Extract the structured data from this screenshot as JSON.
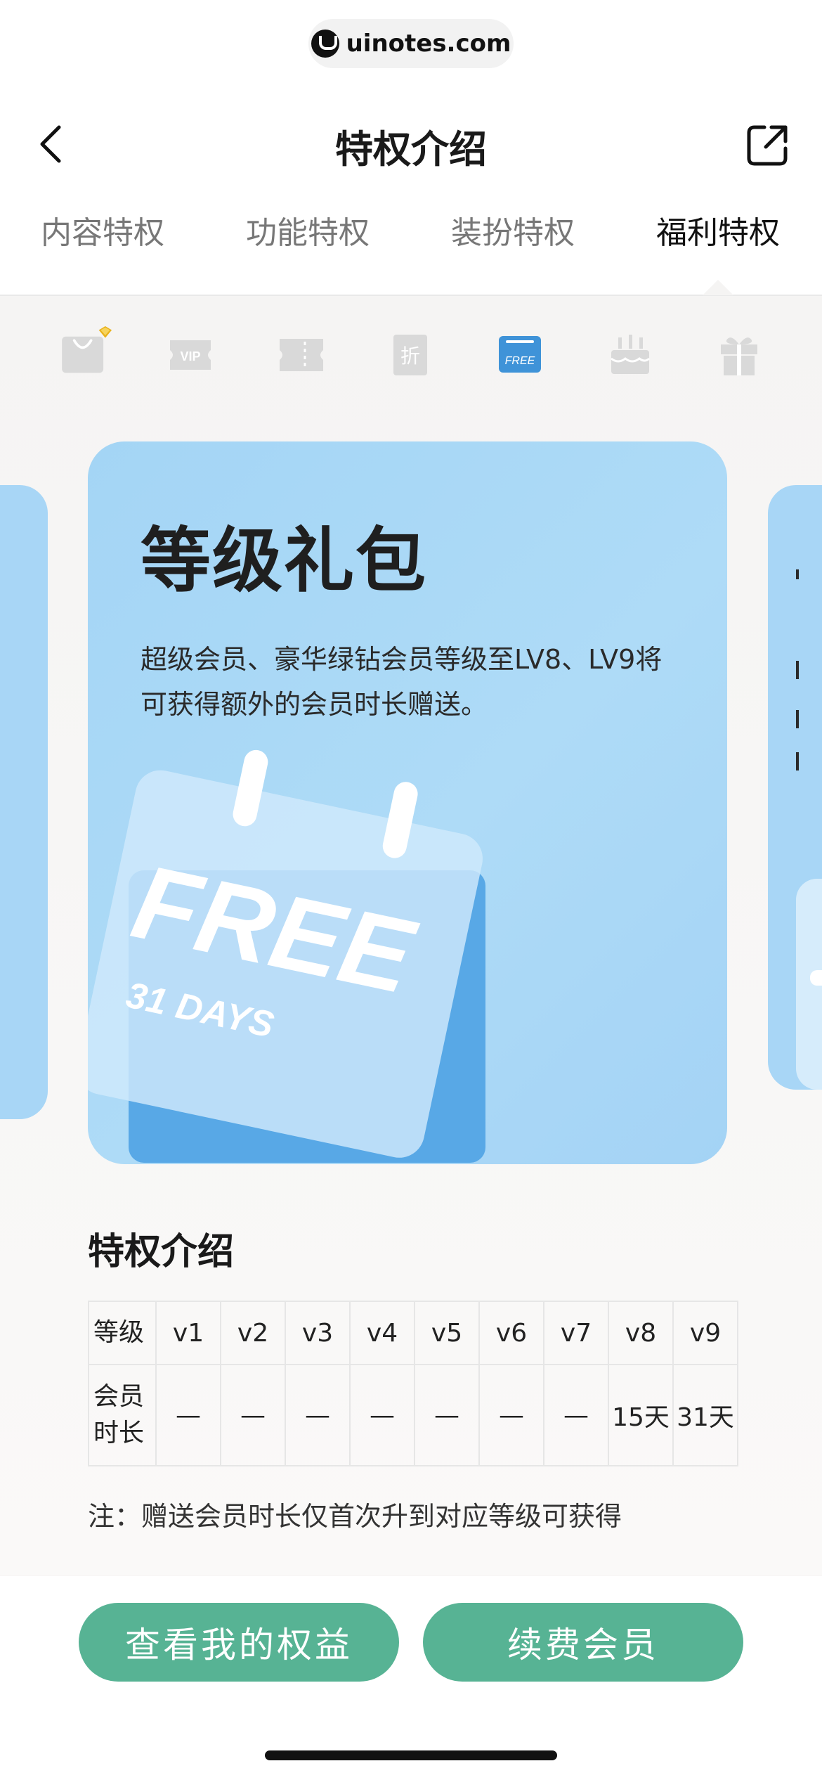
{
  "browser": {
    "url": "uinotes.com"
  },
  "nav": {
    "title": "特权介绍"
  },
  "tabs": [
    {
      "label": "内容特权",
      "active": false
    },
    {
      "label": "功能特权",
      "active": false
    },
    {
      "label": "装扮特权",
      "active": false
    },
    {
      "label": "福利特权",
      "active": true
    }
  ],
  "icon_row": [
    {
      "icon": "shopping-bag-icon",
      "active": false
    },
    {
      "icon": "vip-ticket-icon",
      "active": false,
      "text": "VIP"
    },
    {
      "icon": "coupon-icon",
      "active": false
    },
    {
      "icon": "discount-icon",
      "active": false,
      "text": "折"
    },
    {
      "icon": "free-icon",
      "active": true,
      "text": "FREE"
    },
    {
      "icon": "birthday-cake-icon",
      "active": false
    },
    {
      "icon": "gift-icon",
      "active": false
    }
  ],
  "card": {
    "title": "等级礼包",
    "description": "超级会员、豪华绿钻会员等级至LV8、LV9将可获得额外的会员时长赠送。",
    "art_text_main": "FREE",
    "art_text_sub": "31 DAYS"
  },
  "section": {
    "title": "特权介绍"
  },
  "table": {
    "row_headers": [
      "等级",
      "会员时长"
    ],
    "levels": [
      "v1",
      "v2",
      "v3",
      "v4",
      "v5",
      "v6",
      "v7",
      "v8",
      "v9"
    ],
    "durations": [
      "—",
      "—",
      "—",
      "—",
      "—",
      "—",
      "—",
      "15天",
      "31天"
    ]
  },
  "note": "注：赠送会员时长仅首次升到对应等级可获得",
  "buttons": {
    "view_benefits": "查看我的权益",
    "renew": "续费会员"
  },
  "colors": {
    "accent_green": "#57b394",
    "card_blue": "#a8d6f6",
    "active_icon_blue": "#3f93d8"
  }
}
